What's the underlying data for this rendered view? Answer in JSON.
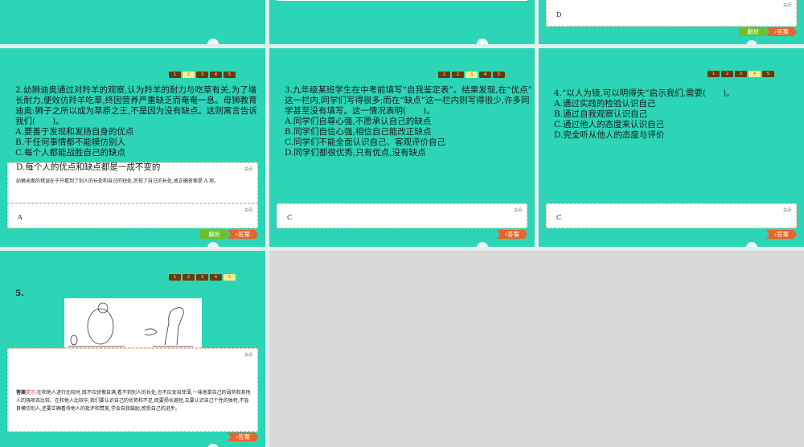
{
  "nav": [
    "1",
    "2",
    "3",
    "4",
    "5"
  ],
  "close_label": "关闭",
  "btn_jiexi": "解析",
  "btn_daan": "›答案",
  "slide_top_right": {
    "answer": "D"
  },
  "slide2": {
    "lines": [
      "2.幼狮迪奥通过对羚羊的观察,认为羚羊的耐力与吃草有关,为了增",
      "长耐力,便效仿羚羊吃草,终因营养严重缺乏而奄奄一息。母狮教育",
      "迪奥:狮子之所以成为草原之王,不是因为没有缺点。这则寓言告诉",
      "我们(　　)。",
      "A.要善于发现和发扬自身的优点",
      "B.干任何事情都不能模仿别人",
      "C.每个人都能战胜自己的缺点",
      "D.每个人的优点和缺点都是一成不变的"
    ],
    "explanation": "幼狮迪奥的错误在于只看到了别人的长处和自己的短处,忽视了自己的长处,故正确答案是 A 项。",
    "answer": "A"
  },
  "slide3": {
    "lines": [
      "3.九年级某班学生在中考前填写“自我鉴定表”。结果发现,在“优点”",
      "这一栏内,同学们写得很多;而在“缺点”这一栏内则写得很少,许多同",
      "学甚至没有填写。这一情况表明(　　)。",
      "A.同学们自尊心强,不愿承认自己的缺点",
      "B.同学们自信心强,相信自己能改正缺点",
      "C.同学们不能全面认识自己、客观评价自己",
      "D.同学们都很优秀,只有优点,没有缺点"
    ],
    "answer": "C"
  },
  "slide4": {
    "lines": [
      "4.“以人为镜,可以明得失”启示我们,需要(　　)。",
      "A.通过实践的检验认识自己",
      "B.通过自我观察认识自己",
      "C.通过他人的态度来认识自己",
      "D.完全听从他人的态度与评价"
    ],
    "answer": "C"
  },
  "slide5": {
    "number": "5.",
    "answer_label": "答案",
    "hint_label": "提示",
    "answer_text": ":在和他人进行比较时,既不应骄傲自满,看不到别人的长处,也不应妄自菲薄,一味地拿自己的弱势和其他人的强项去比较。在和他人比较中,我们要认识自己的优势和不足,既要扬长避短,又要认识自己个性的独特,不盲目模仿别人,还要正确看待他人的批评和赞美,学会自我鼓励,感受自己的进步。"
  }
}
